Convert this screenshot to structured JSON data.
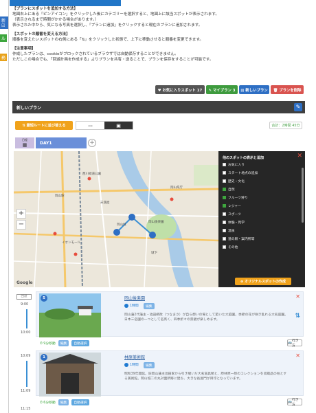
{
  "left_strip": {
    "tabs": [
      {
        "label": "新 ☑",
        "color": "#2e6fc4"
      },
      {
        "label": "ル",
        "color": "#3ea63e"
      },
      {
        "label": "務",
        "color": "#e8a21b"
      }
    ]
  },
  "instructions": {
    "add_heading": "【プランにスポットを追加する方法】",
    "add_lines": [
      "地図右上にある「ピンアイコン」をクリックした後にカテゴリーを選択すると、地図上に該当スポットが表示されます。",
      "（表示されるまで時間がかかる場合があります。）",
      "表示された中から、気になる写真を選択し、「プランに追加」をクリックすると現在のプランに追加されます。"
    ],
    "order_heading": "【スポットの順番を変える方法】",
    "order_lines": [
      "順番を変えたいスポットの右側にある「⇅」をクリックした状態で、上下に移動させると順番を変更できます。"
    ],
    "notes_heading": "【注意事項】",
    "notes_lines": [
      "作成したプランは、cookieがブロックされているブラウザでは自動保存することができません。",
      "ただしこの場合でも、「回遊計画を作成する」よりプランを共有・送ることで、プランを保存をすることが可能です。"
    ]
  },
  "actions": {
    "favorites": "♥ お気に入りスポット 17",
    "my_plans": "✎ マイプラン 3",
    "new_plan": "▤ 新しいプラン",
    "delete_plan": "🗑 プランを削除"
  },
  "plan": {
    "title": "新しいプラン",
    "edit_icon": "pencil-icon"
  },
  "route": {
    "auto_label": "⇅ 最短ルートに並び替える",
    "walk_icon": "walk-icon",
    "car_icon": "car-icon",
    "total": "合計：2時間 45分"
  },
  "days": {
    "calendar_label": "日程",
    "day1": "DAY1",
    "add": "+"
  },
  "map": {
    "labels": [
      "岡山城",
      "岡山後楽園",
      "岡山駅",
      "天満屋",
      "岡山県庁",
      "イオンモール",
      "西川緑道公園",
      "城下"
    ],
    "zoom_in": "+",
    "zoom_out": "−",
    "google": "Google"
  },
  "categories": {
    "title": "他のスポットの表示と追加",
    "close": "✕",
    "items": [
      {
        "label": "お気に入り",
        "checked": false
      },
      {
        "label": "スタート地点の追加",
        "checked": false
      },
      {
        "label": "歴史・文化",
        "checked": false
      },
      {
        "label": "自然",
        "checked": true
      },
      {
        "label": "フルーツ狩り",
        "checked": true
      },
      {
        "label": "レジャー",
        "checked": true
      },
      {
        "label": "スポーツ",
        "checked": false
      },
      {
        "label": "体験・見学",
        "checked": false
      },
      {
        "label": "温泉",
        "checked": false
      },
      {
        "label": "道の駅・案内所等",
        "checked": false
      },
      {
        "label": "その他",
        "checked": false
      }
    ],
    "original_btn": "⊕ オリジナルスポットの作成"
  },
  "timeline": {
    "entries": [
      {
        "tag": "回遊",
        "start": "9:00",
        "end": "10:00",
        "next": "10:09",
        "end2": "11:09",
        "next2": "11:15"
      }
    ]
  },
  "cards": [
    {
      "num": "5",
      "name": "岡山後楽園",
      "duration": "1時間",
      "edit": "編集",
      "desc": "岡山藩2代藩主・池田綱政（つなまさ）が自ら憩いの場として築いた大庭園。季節の花が咲き乱れる大名庭園。日本三名園の一つとして名高く、四季折々の景観が楽しめます。",
      "footer_duration": "⏱ 9分移動",
      "footer_edit": "編集",
      "footer_auto": "自動選択",
      "go": "行き方"
    },
    {
      "num": "1",
      "name": "林原美術館",
      "duration": "1時間",
      "edit": "編集",
      "desc": "昭和39年開館。旧岡山藩主池田家から引き継いだ大名道具類と、原林原一郎のコレクションを収蔵品の柱とする美術館。岡山城二の丸対面所跡に建ち、大きな長屋門が目印となっています。",
      "footer_duration": "⏱ 6分移動",
      "footer_edit": "編集",
      "footer_auto": "自動選択",
      "go": "行き方"
    }
  ],
  "colors": {
    "accent": "#2176c7",
    "orange": "#f0a21b",
    "green": "#3ea63e",
    "red": "#d9534f"
  }
}
